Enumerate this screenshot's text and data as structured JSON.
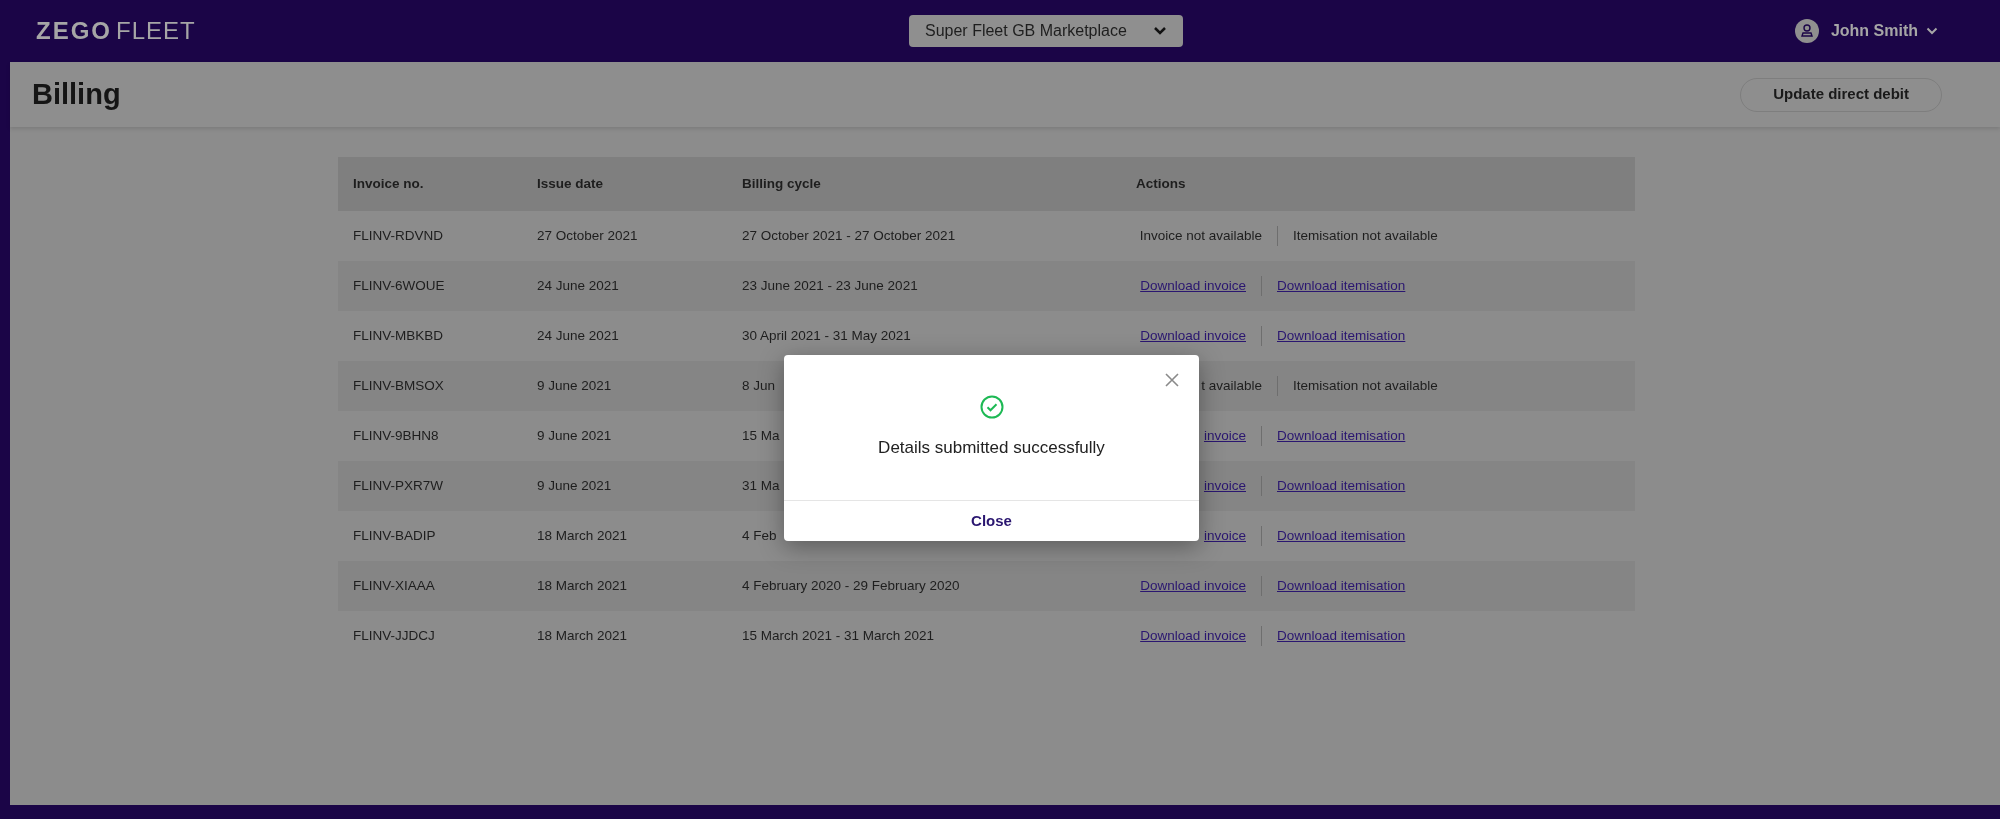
{
  "logo": {
    "brand": "ZEGO",
    "product": "FLEET"
  },
  "account_switcher": {
    "label": "Super Fleet GB Marketplace"
  },
  "user": {
    "name": "John Smith"
  },
  "page": {
    "title": "Billing",
    "action": "Update direct debit"
  },
  "table": {
    "columns": [
      "Invoice no.",
      "Issue date",
      "Billing cycle",
      "Actions"
    ],
    "rows": [
      {
        "invoice": "FLINV-RDVND",
        "issue_date": "27 October 2021",
        "billing_cycle": "27 October 2021 - 27 October 2021",
        "actions": [
          {
            "kind": "text",
            "label": "Invoice not available"
          },
          {
            "kind": "text",
            "label": "Itemisation not available"
          }
        ]
      },
      {
        "invoice": "FLINV-6WOUE",
        "issue_date": "24 June 2021",
        "billing_cycle": "23 June 2021 - 23 June 2021",
        "actions": [
          {
            "kind": "link",
            "label": "Download invoice"
          },
          {
            "kind": "link",
            "label": "Download itemisation"
          }
        ]
      },
      {
        "invoice": "FLINV-MBKBD",
        "issue_date": "24 June 2021",
        "billing_cycle": "30 April 2021 - 31 May 2021",
        "actions": [
          {
            "kind": "link",
            "label": "Download invoice"
          },
          {
            "kind": "link",
            "label": "Download itemisation"
          }
        ]
      },
      {
        "invoice": "FLINV-BMSOX",
        "issue_date": "9 June 2021",
        "billing_cycle": "8 Jun",
        "actions": [
          {
            "kind": "text",
            "label": "t available"
          },
          {
            "kind": "text",
            "label": "Itemisation not available"
          }
        ]
      },
      {
        "invoice": "FLINV-9BHN8",
        "issue_date": "9 June 2021",
        "billing_cycle": "15 Ma",
        "actions": [
          {
            "kind": "link",
            "label": "invoice"
          },
          {
            "kind": "link",
            "label": "Download itemisation"
          }
        ]
      },
      {
        "invoice": "FLINV-PXR7W",
        "issue_date": "9 June 2021",
        "billing_cycle": "31 Ma",
        "actions": [
          {
            "kind": "link",
            "label": "invoice"
          },
          {
            "kind": "link",
            "label": "Download itemisation"
          }
        ]
      },
      {
        "invoice": "FLINV-BADIP",
        "issue_date": "18 March 2021",
        "billing_cycle": "4 Feb",
        "actions": [
          {
            "kind": "link",
            "label": "invoice"
          },
          {
            "kind": "link",
            "label": "Download itemisation"
          }
        ]
      },
      {
        "invoice": "FLINV-XIAAA",
        "issue_date": "18 March 2021",
        "billing_cycle": "4 February 2020 - 29 February 2020",
        "actions": [
          {
            "kind": "link",
            "label": "Download invoice"
          },
          {
            "kind": "link",
            "label": "Download itemisation"
          }
        ]
      },
      {
        "invoice": "FLINV-JJDCJ",
        "issue_date": "18 March 2021",
        "billing_cycle": "15 March 2021 - 31 March 2021",
        "actions": [
          {
            "kind": "link",
            "label": "Download invoice"
          },
          {
            "kind": "link",
            "label": "Download itemisation"
          }
        ]
      }
    ]
  },
  "dialog": {
    "message": "Details submitted successfully",
    "button": "Close"
  }
}
